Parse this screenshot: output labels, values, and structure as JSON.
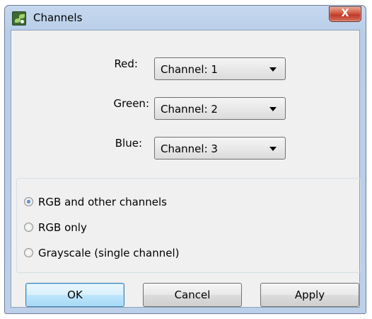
{
  "window": {
    "title": "Channels",
    "close_label": "X"
  },
  "mapping": {
    "rows": [
      {
        "label": "Red:",
        "value": "Channel: 1"
      },
      {
        "label": "Green:",
        "value": "Channel: 2"
      },
      {
        "label": "Blue:",
        "value": "Channel: 3"
      }
    ]
  },
  "mode": {
    "options": [
      {
        "label": "RGB and other channels",
        "checked": true
      },
      {
        "label": "RGB only",
        "checked": false
      },
      {
        "label": "Grayscale (single channel)",
        "checked": false
      }
    ]
  },
  "buttons": {
    "ok": "OK",
    "cancel": "Cancel",
    "apply": "Apply"
  },
  "icons": {
    "app": "channels-app-icon",
    "close": "close-icon",
    "dropdown": "chevron-down-icon",
    "radio": "radio-icon"
  },
  "colors": {
    "accent": "#3c7fb1",
    "close_button": "#c0392a",
    "frame": "#b8cde8"
  }
}
